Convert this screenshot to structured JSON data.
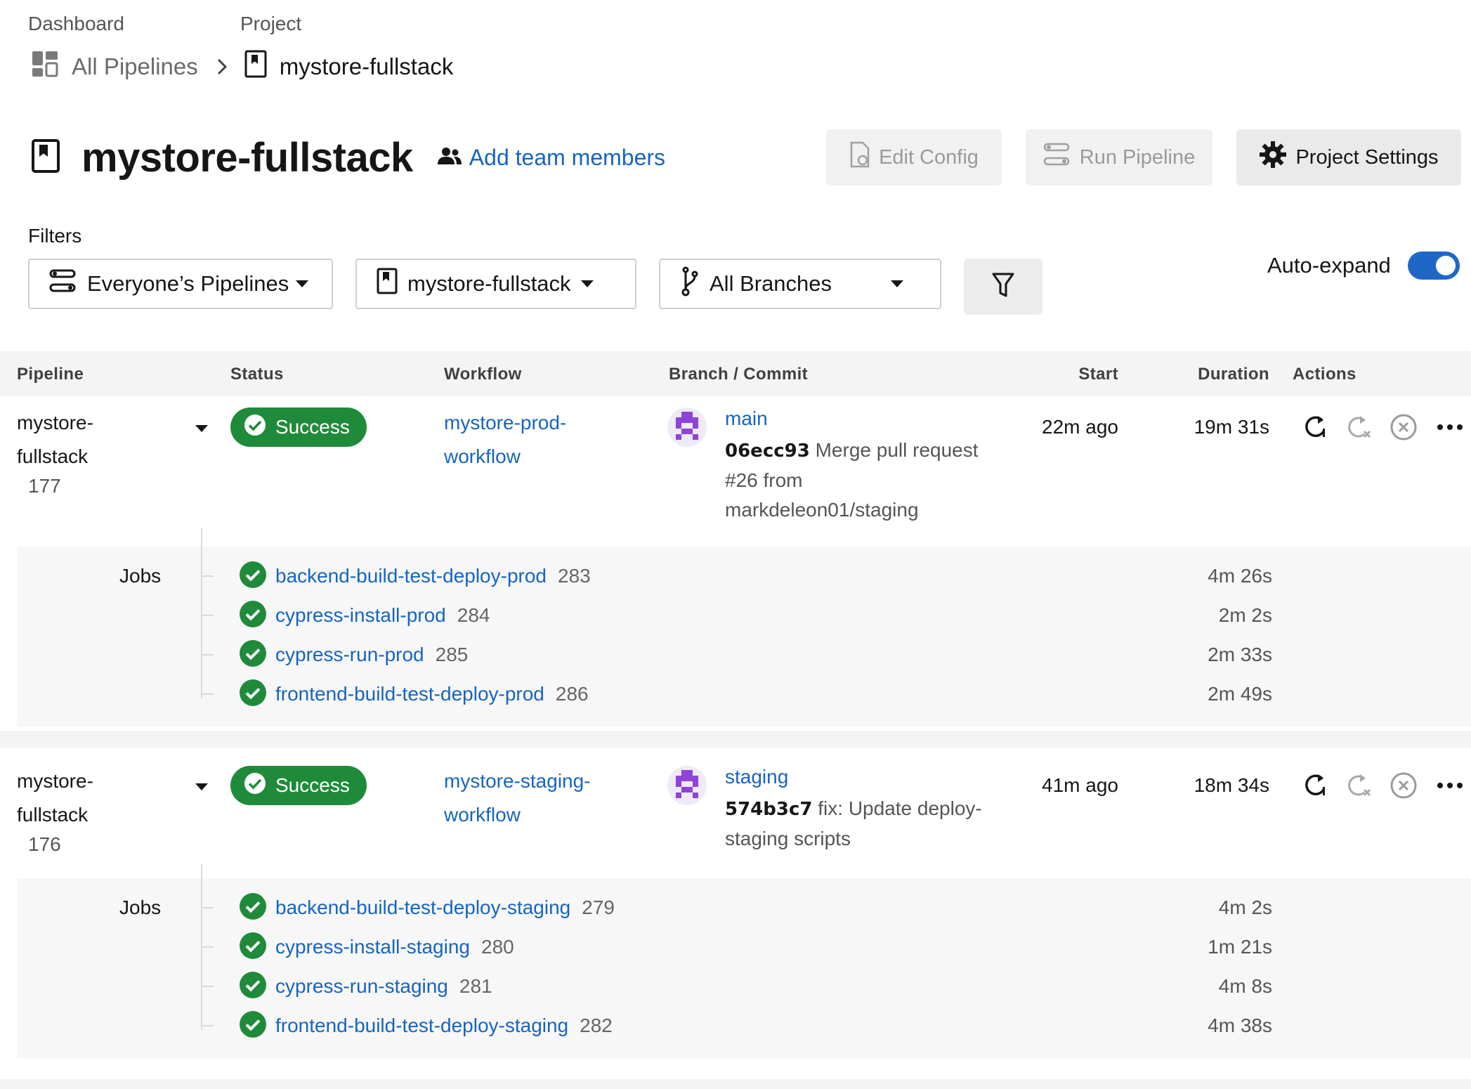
{
  "breadcrumb": {
    "dashboard_label": "Dashboard",
    "project_label": "Project",
    "all_pipelines": "All Pipelines",
    "project_name": "mystore-fullstack"
  },
  "header": {
    "title": "mystore-fullstack",
    "add_team": "Add team members",
    "edit_config": "Edit Config",
    "run_pipeline": "Run Pipeline",
    "project_settings": "Project Settings"
  },
  "filters": {
    "label": "Filters",
    "pipelines": "Everyone’s Pipelines",
    "project": "mystore-fullstack",
    "branches": "All Branches",
    "auto_expand": "Auto-expand",
    "auto_expand_on": true
  },
  "table": {
    "headers": {
      "pipeline": "Pipeline",
      "status": "Status",
      "workflow": "Workflow",
      "branch_commit": "Branch / Commit",
      "start": "Start",
      "duration": "Duration",
      "actions": "Actions"
    },
    "jobs_label": "Jobs"
  },
  "pipelines": [
    {
      "name_line1": "mystore-",
      "name_line2": "fullstack",
      "number": "177",
      "status": "Success",
      "workflow_line1": "mystore-prod-",
      "workflow_line2": "workflow",
      "branch": "main",
      "sha": "06ecc93",
      "commit_line1": " Merge pull request",
      "commit_line2": "#26 from",
      "commit_line3": "markdeleon01/staging",
      "start": "22m ago",
      "duration": "19m 31s",
      "jobs": [
        {
          "name": "backend-build-test-deploy-prod",
          "number": "283",
          "duration": "4m 26s"
        },
        {
          "name": "cypress-install-prod",
          "number": "284",
          "duration": "2m 2s"
        },
        {
          "name": "cypress-run-prod",
          "number": "285",
          "duration": "2m 33s"
        },
        {
          "name": "frontend-build-test-deploy-prod",
          "number": "286",
          "duration": "2m 49s"
        }
      ]
    },
    {
      "name_line1": "mystore-",
      "name_line2": "fullstack",
      "number": "176",
      "status": "Success",
      "workflow_line1": "mystore-staging-",
      "workflow_line2": "workflow",
      "branch": "staging",
      "sha": "574b3c7",
      "commit_line1": " fix: Update deploy-",
      "commit_line2": "staging scripts",
      "commit_line3": "",
      "start": "41m ago",
      "duration": "18m 34s",
      "jobs": [
        {
          "name": "backend-build-test-deploy-staging",
          "number": "279",
          "duration": "4m 2s"
        },
        {
          "name": "cypress-install-staging",
          "number": "280",
          "duration": "1m 21s"
        },
        {
          "name": "cypress-run-staging",
          "number": "281",
          "duration": "4m 8s"
        },
        {
          "name": "frontend-build-test-deploy-staging",
          "number": "282",
          "duration": "4m 38s"
        }
      ]
    }
  ],
  "colors": {
    "success": "#1f8b3a",
    "link": "#1565c0",
    "toggle": "#1f67c7"
  }
}
